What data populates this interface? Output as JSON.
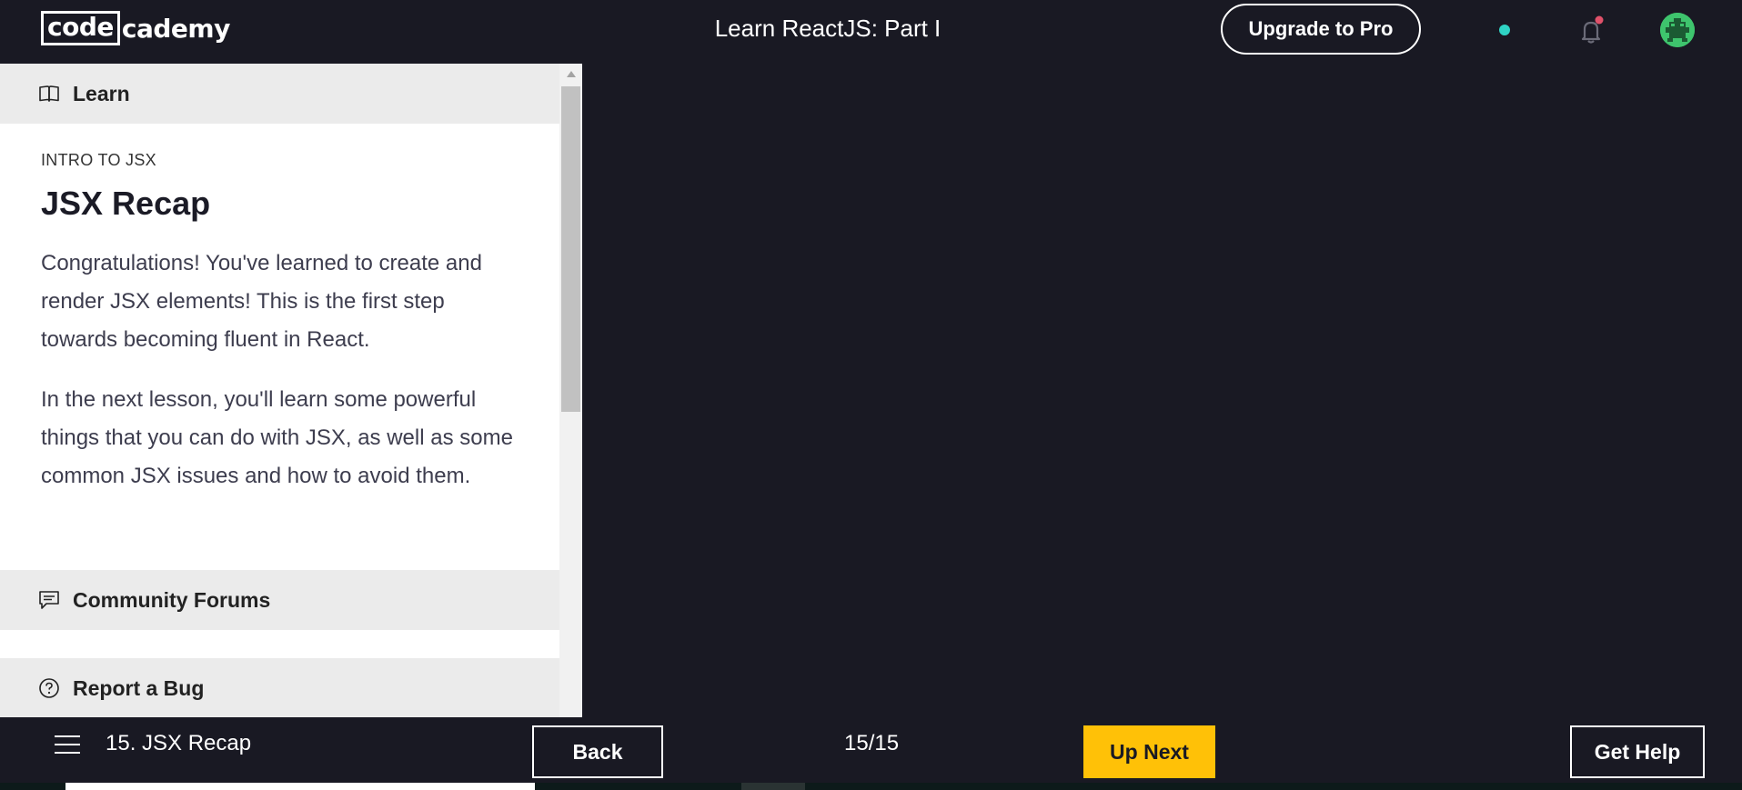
{
  "header": {
    "logo_boxed": "code",
    "logo_rest": "cademy",
    "course_title": "Learn ReactJS: Part I",
    "upgrade_label": "Upgrade to Pro"
  },
  "panel": {
    "learn_label": "Learn",
    "eyebrow": "INTRO TO JSX",
    "title": "JSX Recap",
    "paragraphs": [
      "Congratulations! You've learned to create and render JSX elements! This is the first step towards becoming fluent in React.",
      "In the next lesson, you'll learn some powerful things that you can do with JSX, as well as some common JSX issues and how to avoid them."
    ],
    "forums_label": "Community Forums",
    "bug_label": "Report a Bug"
  },
  "footer": {
    "lesson_name": "15. JSX Recap",
    "back_label": "Back",
    "progress": "15/15",
    "next_label": "Up Next",
    "help_label": "Get Help"
  },
  "colors": {
    "background": "#191923",
    "accent_yellow": "#ffc107",
    "status_teal": "#2fd3c4",
    "avatar_green": "#3ec46d",
    "notification_red": "#e0516a"
  },
  "icons": [
    "book-icon",
    "bell-icon",
    "avatar-icon",
    "chat-icon",
    "help-circle-icon",
    "menu-icon"
  ]
}
